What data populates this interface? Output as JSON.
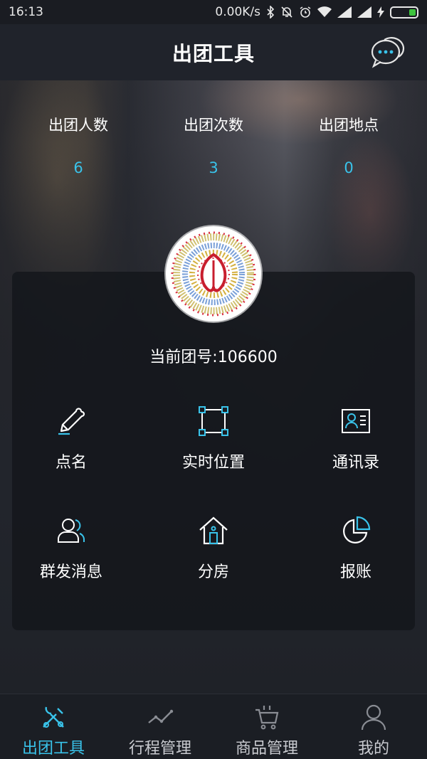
{
  "status_bar": {
    "time": "16:13",
    "network_speed": "0.00K/s",
    "icons": [
      "bluetooth-icon",
      "mute-icon",
      "alarm-icon",
      "wifi-icon",
      "signal-icon",
      "signal-icon",
      "charging-icon",
      "battery-icon"
    ]
  },
  "header": {
    "title": "出团工具",
    "chat_icon": "chat-bubbles-icon"
  },
  "stats": [
    {
      "label": "出团人数",
      "value": "6"
    },
    {
      "label": "出团次数",
      "value": "3"
    },
    {
      "label": "出团地点",
      "value": "0"
    }
  ],
  "group": {
    "current_group_label": "当前团号:106600"
  },
  "tools": [
    {
      "label": "点名",
      "icon": "pencil-icon"
    },
    {
      "label": "实时位置",
      "icon": "location-frame-icon"
    },
    {
      "label": "通讯录",
      "icon": "contact-card-icon"
    },
    {
      "label": "群发消息",
      "icon": "users-icon"
    },
    {
      "label": "分房",
      "icon": "house-icon"
    },
    {
      "label": "报账",
      "icon": "pie-chart-icon"
    }
  ],
  "tabs": [
    {
      "label": "出团工具",
      "icon": "tools-icon",
      "active": true
    },
    {
      "label": "行程管理",
      "icon": "trend-line-icon",
      "active": false
    },
    {
      "label": "商品管理",
      "icon": "cart-icon",
      "active": false
    },
    {
      "label": "我的",
      "icon": "user-icon",
      "active": false
    }
  ],
  "colors": {
    "accent": "#39c3ea",
    "background": "#1c1f26",
    "header": "#20232b",
    "battery": "#3ec43e"
  }
}
